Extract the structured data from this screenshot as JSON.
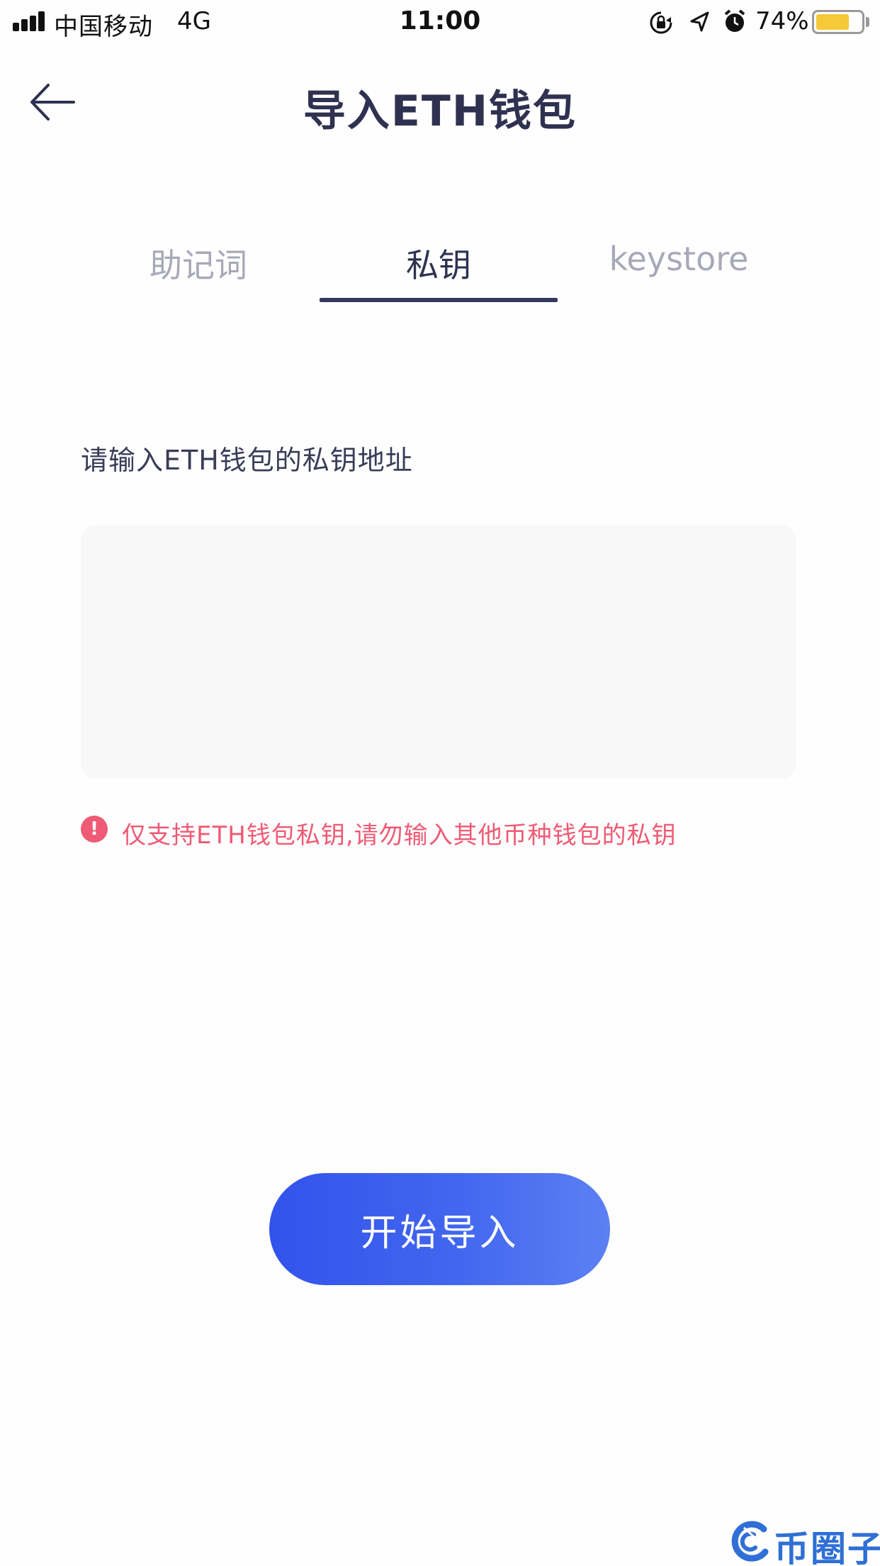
{
  "status_bar": {
    "carrier": "中国移动",
    "network": "4G",
    "time": "11:00",
    "battery_percent_label": "74%",
    "battery_level": 0.74,
    "battery_color": "#f5c938",
    "icons": [
      "signal-icon",
      "rotation-lock-icon",
      "location-arrow-icon",
      "alarm-icon",
      "battery-icon"
    ]
  },
  "header": {
    "title": "导入ETH钱包",
    "back_icon": "arrow-left-icon"
  },
  "tabs": [
    {
      "label": "助记词",
      "active": false
    },
    {
      "label": "私钥",
      "active": true
    },
    {
      "label": "keystore",
      "active": false
    }
  ],
  "form": {
    "label": "请输入ETH钱包的私钥地址",
    "input_value": "",
    "input_placeholder": "",
    "warning_icon": "!",
    "warning_text": "仅支持ETH钱包私钥,请勿输入其他币种钱包的私钥",
    "warning_color": "#ee5b74"
  },
  "actions": {
    "import_label": "开始导入",
    "accent_color": "#3253ec"
  },
  "watermark": {
    "text": "币圈子",
    "color": "#2f6fd6"
  }
}
